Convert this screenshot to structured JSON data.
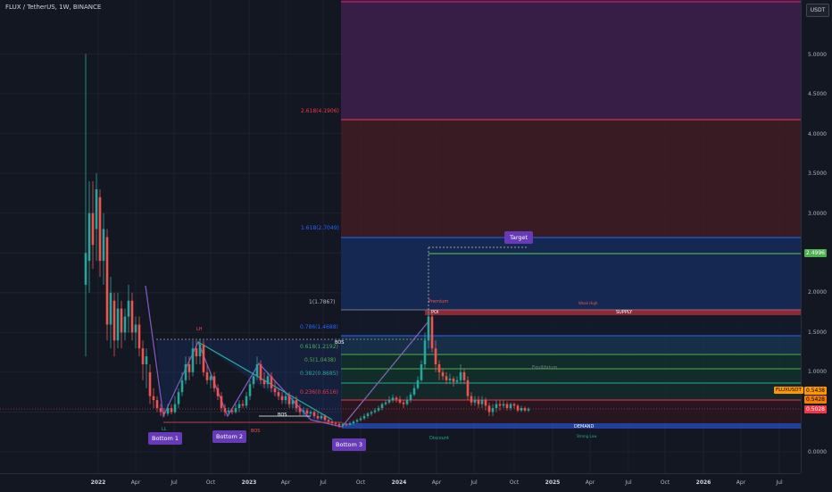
{
  "header": {
    "title": "FLUX / TetherUS, 1W, BINANCE",
    "currency_button": "USDT"
  },
  "price_axis": {
    "ticks": [
      "5.0000",
      "4.5000",
      "4.0000",
      "3.5000",
      "3.0000",
      "2.5000",
      "2.0000",
      "1.5000",
      "1.0000",
      "0.5000",
      "0.0000"
    ],
    "price_badges": [
      {
        "label": "2.4996",
        "color": "#4caf50"
      },
      {
        "label": "0.5438",
        "color": "#ff9800"
      },
      {
        "label": "0.5428",
        "color": "#f57c00"
      },
      {
        "label": "0.5028",
        "color": "#f23645"
      }
    ]
  },
  "time_axis": {
    "labels": [
      "2022",
      "Apr",
      "Jul",
      "Oct",
      "2023",
      "Apr",
      "Jul",
      "Oct",
      "2024",
      "Apr",
      "Jul",
      "Oct",
      "2025",
      "Apr",
      "Jul",
      "Oct",
      "2026",
      "Apr",
      "Jul"
    ],
    "bold": [
      "2022",
      "2023",
      "2024",
      "2025",
      "2026"
    ]
  },
  "fib_levels": [
    {
      "label": "2.618(4.1906)",
      "color": "#f23645"
    },
    {
      "label": "1.618(2.7049)",
      "color": "#2962ff"
    },
    {
      "label": "1(1.7867)",
      "color": "#b2b5be"
    },
    {
      "label": "0.786(1.4688)",
      "color": "#2962ff"
    },
    {
      "label": "0.618(1.2192)",
      "color": "#4caf50"
    },
    {
      "label": "0.5(1.0438)",
      "color": "#4caf50"
    },
    {
      "label": "0.382(0.8685)",
      "color": "#26a69a"
    },
    {
      "label": "0.236(0.6516)",
      "color": "#f23645"
    }
  ],
  "annotations": {
    "target": "Target",
    "premium": "Premium",
    "poi": "POI",
    "weak_high": "Weak High",
    "supply": "SUPPLY",
    "equilibrium": "Equilibrium",
    "demand": "DEMAND",
    "strong_low": "Strong Low",
    "discount": "Discount",
    "bos_labels": [
      "BOS",
      "BOS",
      "BOS"
    ],
    "lh": "LH",
    "ll": "LL",
    "ticker_tag": "FLUXUSDT"
  },
  "bottoms": [
    {
      "label": "Bottom 1"
    },
    {
      "label": "Bottom 2"
    },
    {
      "label": "Bottom 3"
    }
  ],
  "colors": {
    "background": "#131722",
    "up_candle": "#26a69a",
    "down_candle": "#ef5350",
    "bottom_box": "#673ab7",
    "pattern": "#7e57c2"
  },
  "chart_data": {
    "type": "candlestick",
    "title": "FLUX / TetherUS, 1W, BINANCE",
    "ylim": [
      0,
      5.5
    ],
    "x_ticks": [
      "2022",
      "Apr",
      "Jul",
      "Oct",
      "2023",
      "Apr",
      "Jul",
      "Oct",
      "2024",
      "Apr",
      "Jul",
      "Oct",
      "2025",
      "Apr",
      "Jul",
      "Oct",
      "2026",
      "Apr",
      "Jul"
    ],
    "key_points": [
      {
        "x": "Dec 2021",
        "y": 5.0,
        "label": "all-time high wick"
      },
      {
        "x": "Jun 2022",
        "y": 0.45,
        "label": "Bottom 1"
      },
      {
        "x": "Aug 2022",
        "y": 1.4,
        "label": "LH"
      },
      {
        "x": "Nov 2022",
        "y": 0.48,
        "label": "Bottom 2"
      },
      {
        "x": "Aug 2023",
        "y": 0.33,
        "label": "Bottom 3"
      },
      {
        "x": "Mar 2024",
        "y": 1.7,
        "label": "Premium"
      },
      {
        "x": "Oct 2024",
        "y": 0.54,
        "label": "last price"
      }
    ]
  }
}
